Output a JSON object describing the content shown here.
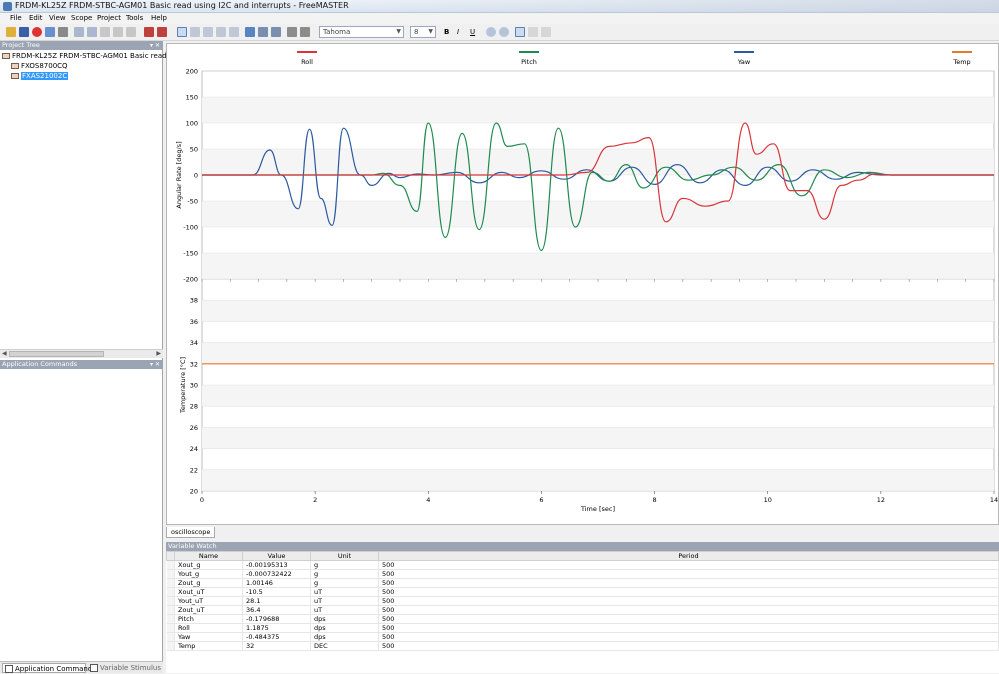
{
  "window": {
    "title": "FRDM-KL25Z FRDM-STBC-AGM01 Basic read using I2C and interrupts - FreeMASTER"
  },
  "menu": [
    "File",
    "Edit",
    "View",
    "Scope",
    "Project",
    "Tools",
    "Help"
  ],
  "toolbar": {
    "font_name": "Tahoma",
    "font_size": "8",
    "format_icons": [
      "bold-icon",
      "italic-icon",
      "underline-icon",
      "strikethrough-icon",
      "zoom-in-icon",
      "zoom-out-icon",
      "align-left-icon",
      "align-center-icon",
      "align-right-icon"
    ]
  },
  "project_tree": {
    "header": "Project Tree",
    "root": "FRDM-KL25Z FRDM-STBC-AGM01 Basic read using",
    "children": [
      "FXOS8700CQ",
      "FXAS21002C"
    ],
    "selected": "FXAS21002C"
  },
  "app_commands": {
    "header": "Application Commands"
  },
  "bottom_tabs": [
    "Application Commands",
    "Variable Stimulus"
  ],
  "oscilloscope_tab": "oscilloscope",
  "chart_data": [
    {
      "type": "line",
      "legend": [
        "Roll",
        "Pitch",
        "Yaw",
        "Temp"
      ],
      "legend_placement": "top",
      "colors": {
        "Roll": "#d8353a",
        "Pitch": "#1f8a4c",
        "Yaw": "#2c5aa0",
        "Temp": "#e8772e"
      },
      "xlabel": "Time [sec]",
      "ylabel": "Angular Rate [deg/s]",
      "xlim": [
        0,
        14
      ],
      "ylim": [
        -200,
        200
      ],
      "xticks": [
        0,
        2,
        4,
        6,
        8,
        10,
        12,
        14
      ],
      "yticks": [
        200,
        150,
        100,
        50,
        0,
        -50,
        -100,
        -150,
        -200
      ],
      "grid": true,
      "series": [
        {
          "name": "Yaw",
          "x": [
            0,
            0.9,
            1.2,
            1.4,
            1.7,
            1.9,
            2.1,
            2.3,
            2.5,
            2.8,
            3.0,
            3.3,
            3.5,
            3.8,
            4.1,
            4.5,
            4.9,
            5.3,
            5.6,
            6.0,
            6.4,
            6.8,
            7.2,
            7.6,
            8.0,
            8.4,
            8.8,
            9.2,
            9.6,
            10.0,
            10.4,
            10.8,
            11.2,
            11.6,
            12.0,
            14
          ],
          "y": [
            0,
            0,
            48,
            0,
            -65,
            88,
            -45,
            -97,
            90,
            0,
            -20,
            3,
            -5,
            2,
            0,
            5,
            -15,
            5,
            -5,
            8,
            -8,
            10,
            -12,
            15,
            -18,
            20,
            -15,
            10,
            -20,
            15,
            -12,
            10,
            -8,
            5,
            0,
            0
          ]
        },
        {
          "name": "Pitch",
          "x": [
            0,
            3.0,
            3.2,
            3.5,
            3.8,
            4.0,
            4.3,
            4.6,
            4.9,
            5.2,
            5.4,
            5.7,
            6.0,
            6.3,
            6.6,
            6.9,
            7.2,
            7.5,
            7.8,
            8.2,
            8.6,
            9.0,
            9.4,
            9.8,
            10.2,
            10.6,
            11.0,
            11.4,
            11.8,
            12.2,
            14
          ],
          "y": [
            0,
            0,
            3,
            -20,
            -70,
            100,
            -120,
            80,
            -105,
            100,
            55,
            60,
            -145,
            90,
            -100,
            5,
            -12,
            20,
            -25,
            15,
            -10,
            0,
            15,
            -10,
            20,
            -40,
            10,
            -5,
            5,
            0,
            0
          ]
        },
        {
          "name": "Roll",
          "x": [
            0,
            6.4,
            6.8,
            7.2,
            7.6,
            7.9,
            8.2,
            8.5,
            8.9,
            9.3,
            9.6,
            9.8,
            10.1,
            10.4,
            10.7,
            11.0,
            11.3,
            11.6,
            11.9,
            12.2,
            14
          ],
          "y": [
            0,
            0,
            5,
            55,
            62,
            72,
            -90,
            -45,
            -60,
            -50,
            100,
            40,
            60,
            -30,
            -30,
            -85,
            -20,
            -10,
            2,
            0,
            0
          ]
        },
        {
          "name": "Temp",
          "x": [
            0,
            14
          ],
          "y": [
            32,
            32
          ]
        }
      ]
    },
    {
      "type": "line",
      "xlabel": "Time [sec]",
      "ylabel": "Temperature [°C]",
      "xlim": [
        0,
        14
      ],
      "ylim": [
        20,
        40
      ],
      "xticks": [
        0,
        2,
        4,
        6,
        8,
        10,
        12,
        14
      ],
      "yticks": [
        38,
        36,
        34,
        32,
        30,
        28,
        26,
        24,
        22,
        20
      ],
      "grid": true,
      "series": [
        {
          "name": "Temp",
          "x": [
            0,
            14
          ],
          "y": [
            32,
            32
          ]
        }
      ]
    }
  ],
  "variable_watch": {
    "header": "Variable Watch",
    "columns": [
      "Name",
      "Value",
      "Unit",
      "Period"
    ],
    "rows": [
      [
        "Xout_g",
        "-0.00195313",
        "g",
        "500"
      ],
      [
        "Yout_g",
        "-0.000732422",
        "g",
        "500"
      ],
      [
        "Zout_g",
        "1.00146",
        "g",
        "500"
      ],
      [
        "Xout_uT",
        "-10.5",
        "uT",
        "500"
      ],
      [
        "Yout_uT",
        "28.1",
        "uT",
        "500"
      ],
      [
        "Zout_uT",
        "36.4",
        "uT",
        "500"
      ],
      [
        "Pitch",
        "-0.179688",
        "dps",
        "500"
      ],
      [
        "Roll",
        "1.1875",
        "dps",
        "500"
      ],
      [
        "Yaw",
        "-0.484375",
        "dps",
        "500"
      ],
      [
        "Temp",
        "32",
        "DEC",
        "500"
      ]
    ]
  }
}
